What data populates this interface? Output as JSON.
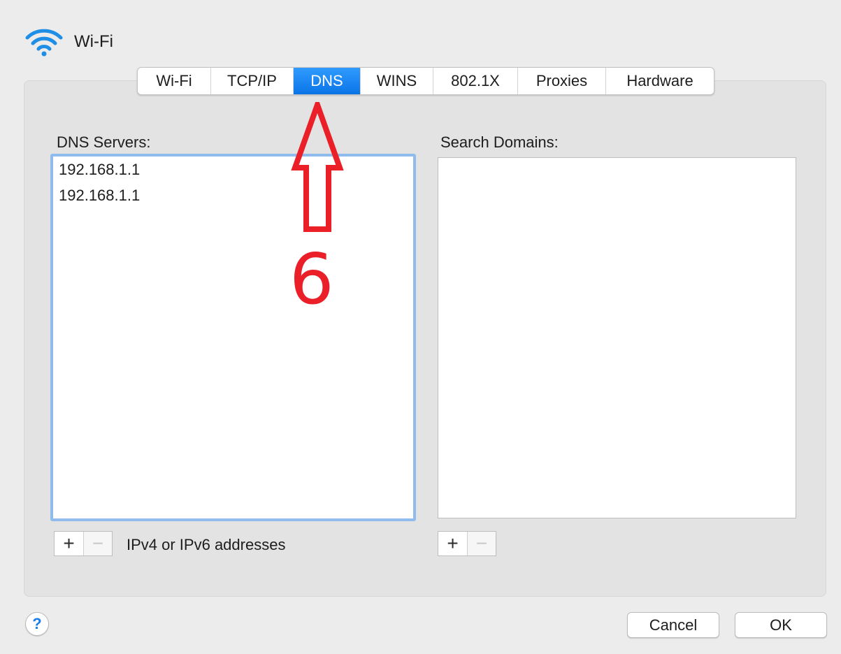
{
  "window": {
    "title": "Wi-Fi",
    "icon": "wifi-icon",
    "accent_color": "#0a74e6"
  },
  "tabs": [
    {
      "label": "Wi-Fi",
      "active": false
    },
    {
      "label": "TCP/IP",
      "active": false
    },
    {
      "label": "DNS",
      "active": true
    },
    {
      "label": "WINS",
      "active": false
    },
    {
      "label": "802.1X",
      "active": false
    },
    {
      "label": "Proxies",
      "active": false
    },
    {
      "label": "Hardware",
      "active": false
    }
  ],
  "dns_servers": {
    "label": "DNS Servers:",
    "items": [
      "192.168.1.1",
      "192.168.1.1"
    ],
    "add_label": "+",
    "remove_label": "−",
    "hint": "IPv4 or IPv6 addresses"
  },
  "search_domains": {
    "label": "Search Domains:",
    "items": [],
    "add_label": "+",
    "remove_label": "−"
  },
  "footer": {
    "help_label": "?",
    "cancel_label": "Cancel",
    "ok_label": "OK"
  },
  "annotation": {
    "step_number": "6",
    "color": "#ea1f28"
  }
}
